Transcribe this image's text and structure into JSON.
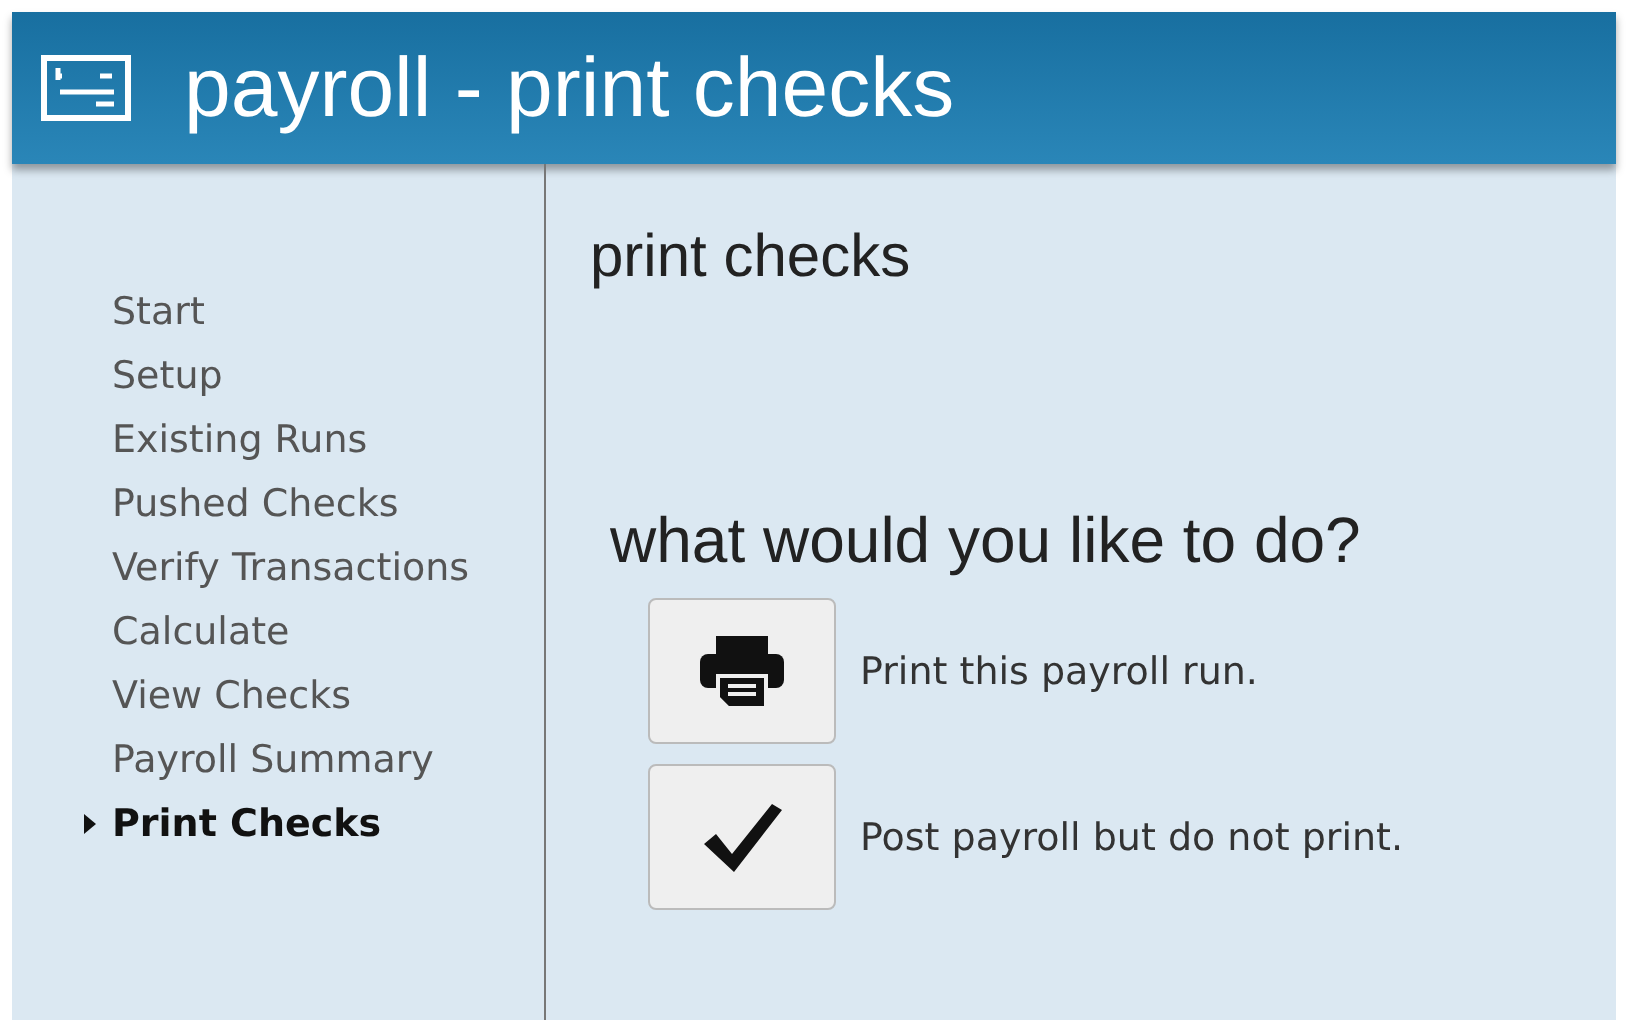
{
  "header": {
    "title": "payroll - print checks"
  },
  "sidebar": {
    "items": [
      {
        "label": "Start",
        "selected": false
      },
      {
        "label": "Setup",
        "selected": false
      },
      {
        "label": "Existing Runs",
        "selected": false
      },
      {
        "label": "Pushed Checks",
        "selected": false
      },
      {
        "label": "Verify Transactions",
        "selected": false
      },
      {
        "label": "Calculate",
        "selected": false
      },
      {
        "label": "View Checks",
        "selected": false
      },
      {
        "label": "Payroll Summary",
        "selected": false
      },
      {
        "label": "Print Checks",
        "selected": true
      }
    ]
  },
  "content": {
    "title": "print checks",
    "question": "what would you like to do?",
    "actions": [
      {
        "kind": "print",
        "label": "Print this payroll run."
      },
      {
        "kind": "post",
        "label": "Post payroll but do not print."
      }
    ]
  }
}
